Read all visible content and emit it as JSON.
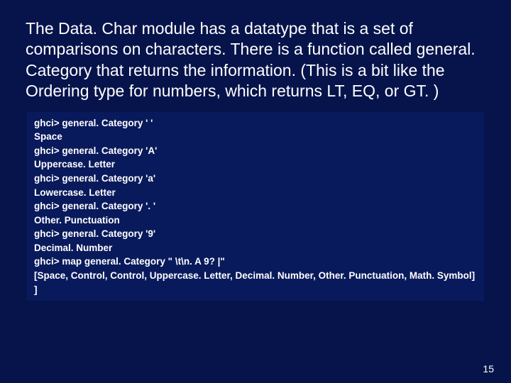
{
  "heading": "The Data. Char module has a datatype that is a set of comparisons on characters.  There is a function called general. Category that returns the information.  (This is a bit like the Ordering type for numbers, which returns LT, EQ, or GT. )",
  "code": "ghci> general. Category ' '\nSpace\nghci> general. Category 'A'\nUppercase. Letter\nghci> general. Category 'a'\nLowercase. Letter\nghci> general. Category '. '\nOther. Punctuation\nghci> general. Category '9'\nDecimal. Number\nghci> map general. Category \" \\t\\n. A 9? |\"\n[Space, Control, Control, Uppercase. Letter, Decimal. Number, Other. Punctuation, Math. Symbol]  ]",
  "pagenum": "15"
}
